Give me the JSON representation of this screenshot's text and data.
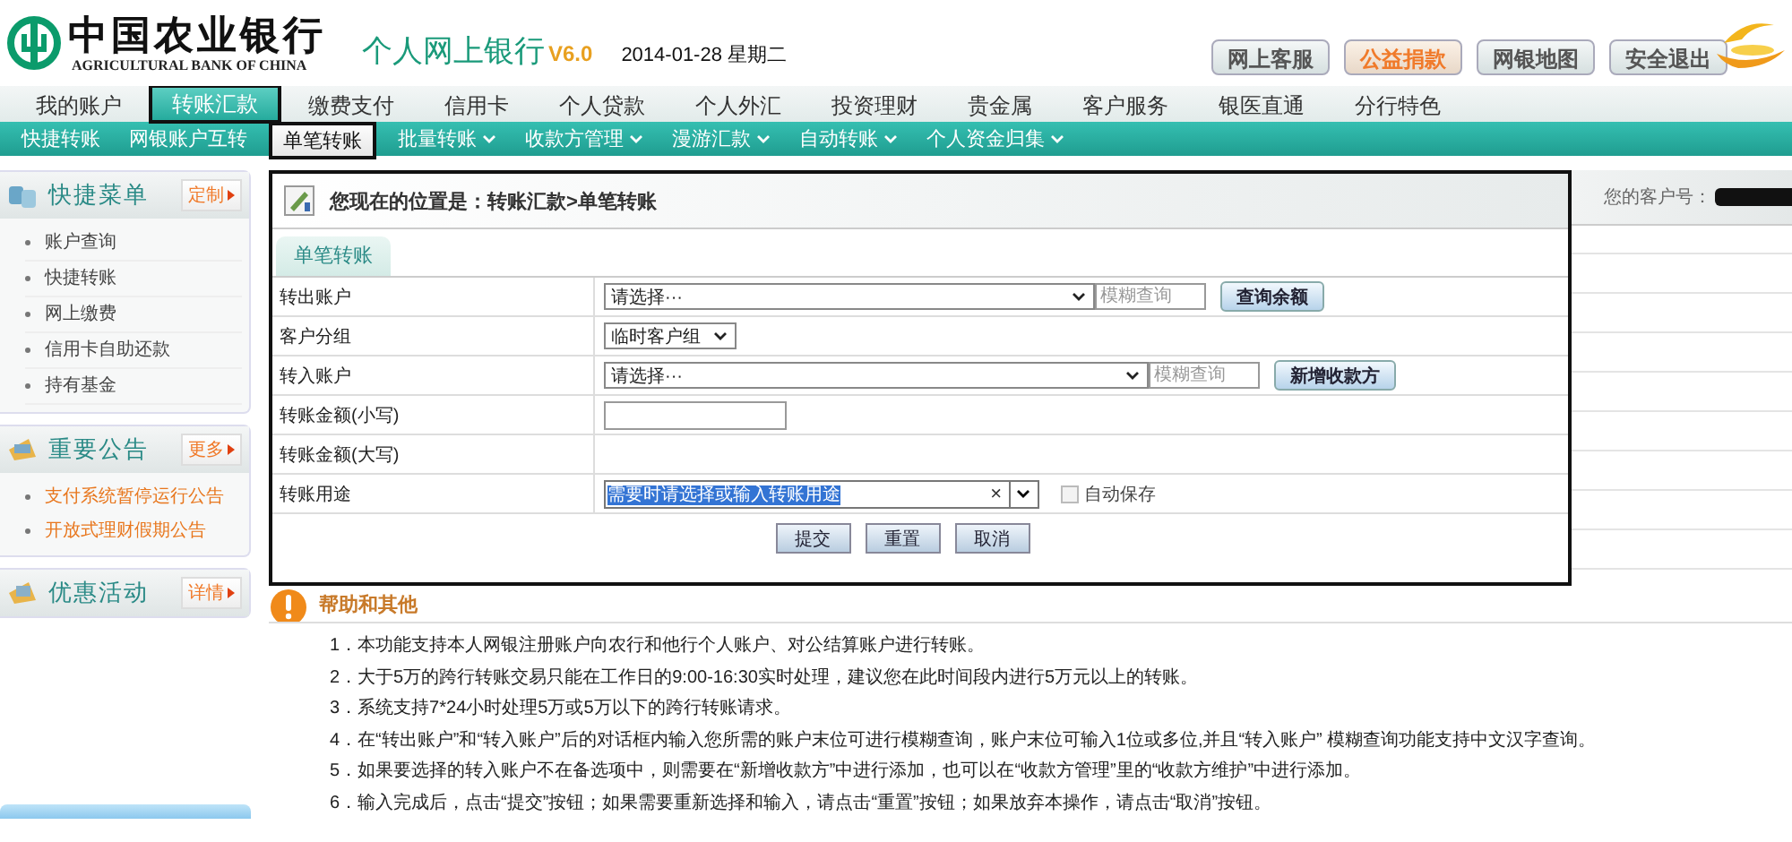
{
  "header": {
    "bank_name": "中国农业银行",
    "bank_name_en": "AGRICULTURAL BANK OF CHINA",
    "product": "个人网上银行",
    "version": "V6.0",
    "date": "2014-01-28 星期二",
    "buttons": [
      {
        "label": "网上客服",
        "highlighted": false
      },
      {
        "label": "公益捐款",
        "highlighted": true
      },
      {
        "label": "网银地图",
        "highlighted": false
      },
      {
        "label": "安全退出",
        "highlighted": false
      }
    ]
  },
  "main_nav": [
    {
      "label": "我的账户",
      "selected": false
    },
    {
      "label": "转账汇款",
      "selected": true
    },
    {
      "label": "缴费支付",
      "selected": false
    },
    {
      "label": "信用卡",
      "selected": false
    },
    {
      "label": "个人贷款",
      "selected": false
    },
    {
      "label": "个人外汇",
      "selected": false
    },
    {
      "label": "投资理财",
      "selected": false
    },
    {
      "label": "贵金属",
      "selected": false
    },
    {
      "label": "客户服务",
      "selected": false
    },
    {
      "label": "银医直通",
      "selected": false
    },
    {
      "label": "分行特色",
      "selected": false
    }
  ],
  "sub_nav": [
    {
      "label": "快捷转账",
      "selected": false,
      "dropdown": false
    },
    {
      "label": "网银账户互转",
      "selected": false,
      "dropdown": false
    },
    {
      "label": "单笔转账",
      "selected": true,
      "dropdown": false
    },
    {
      "label": "批量转账",
      "selected": false,
      "dropdown": true
    },
    {
      "label": "收款方管理",
      "selected": false,
      "dropdown": true
    },
    {
      "label": "漫游汇款",
      "selected": false,
      "dropdown": true
    },
    {
      "label": "自动转账",
      "selected": false,
      "dropdown": true
    },
    {
      "label": "个人资金归集",
      "selected": false,
      "dropdown": true
    }
  ],
  "sidebar": [
    {
      "kind": "menu",
      "title": "快捷菜单",
      "action": "定制",
      "items": [
        "账户查询",
        "快捷转账",
        "网上缴费",
        "信用卡自助还款",
        "持有基金"
      ]
    },
    {
      "kind": "notice",
      "title": "重要公告",
      "action": "更多",
      "items": [
        "支付系统暂停运行公告",
        "开放式理财假期公告"
      ]
    },
    {
      "kind": "promo",
      "title": "优惠活动",
      "action": "详情"
    }
  ],
  "breadcrumb": "您现在的位置是：转账汇款>单笔转账",
  "customer_label": "您的客户号：",
  "form": {
    "tab": {
      "label": "单笔转账",
      "selected": true
    },
    "rows": [
      {
        "kind": "select_search",
        "label": "转出账户",
        "value": "请选择···",
        "search_placeholder": "模糊查询",
        "button": "查询余额"
      },
      {
        "kind": "select",
        "label": "客户分组",
        "value": "临时客户组"
      },
      {
        "kind": "select_search",
        "label": "转入账户",
        "value": "请选择···",
        "search_placeholder": "模糊查询",
        "button": "新增收款方"
      },
      {
        "kind": "input",
        "label": "转账金额(小写)"
      },
      {
        "kind": "text",
        "label": "转账金额(大写)"
      },
      {
        "kind": "combo",
        "label": "转账用途",
        "value": "需要时请选择或输入转账用途",
        "value_selected": true,
        "clear": "×",
        "checkbox": {
          "label": "自动保存",
          "checked": false
        }
      }
    ],
    "actions": [
      "提交",
      "重置",
      "取消"
    ]
  },
  "help": {
    "title": "帮助和其他",
    "items": [
      "1．本功能支持本人网银注册账户向农行和他行个人账户、对公结算账户进行转账。",
      "2．大于5万的跨行转账交易只能在工作日的9:00-16:30实时处理，建议您在此时间段内进行5万元以上的转账。",
      "3．系统支持7*24小时处理5万或5万以下的跨行转账请求。",
      "4．在“转出账户”和“转入账户”后的对话框内输入您所需的账户末位可进行模糊查询，账户末位可输入1位或多位,并且“转入账户” 模糊查询功能支持中文汉字查询。",
      "5．如果要选择的转入账户不在备选项中，则需要在“新增收款方”中进行添加，也可以在“收款方管理”里的“收款方维护”中进行添加。",
      "6．输入完成后，点击“提交”按钮；如果需要重新选择和输入，请点击“重置”按钮；如果放弃本操作，请点击“取消”按钮。"
    ]
  }
}
